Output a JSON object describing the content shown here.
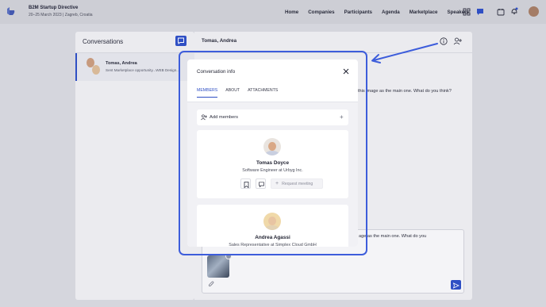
{
  "event": {
    "title": "B2M Startup Directive",
    "subtitle": "20–25 March 2023 | Zagreb, Croatia"
  },
  "nav": [
    "Home",
    "Companies",
    "Participants",
    "Agenda",
    "Marketplace",
    "Speakers"
  ],
  "nav_icons": [
    "apps-icon",
    "chat-icon",
    "calendar-icon",
    "bell-icon",
    "user-avatar"
  ],
  "conversations": {
    "heading": "Conversations",
    "items": [
      {
        "name": "Tomas, Andrea",
        "preview": "Sent Marketplace opportunity...WEB Design..."
      }
    ]
  },
  "chat": {
    "title": "Tomas, Andrea",
    "visible_message": "this image as the main one. What do you think?",
    "composer_text": "age as the main one. What do you"
  },
  "modal": {
    "title": "Conversation info",
    "tabs": [
      {
        "label": "MEMBERS",
        "active": true
      },
      {
        "label": "ABOUT",
        "active": false
      },
      {
        "label": "ATTACHMENTS",
        "active": false
      }
    ],
    "add_members_label": "Add members",
    "members": [
      {
        "name": "Tomas Doyce",
        "role": "Software Engineer at Urbyg Inc.",
        "request_label": "Request meeting"
      },
      {
        "name": "Andrea Agassi",
        "role": "Sales Representative at Simplex Cloud GmbH"
      }
    ]
  },
  "colors": {
    "accent": "#2f4fc4",
    "highlight": "#3d5ddb",
    "overlay_background": "#d5d6dd"
  }
}
